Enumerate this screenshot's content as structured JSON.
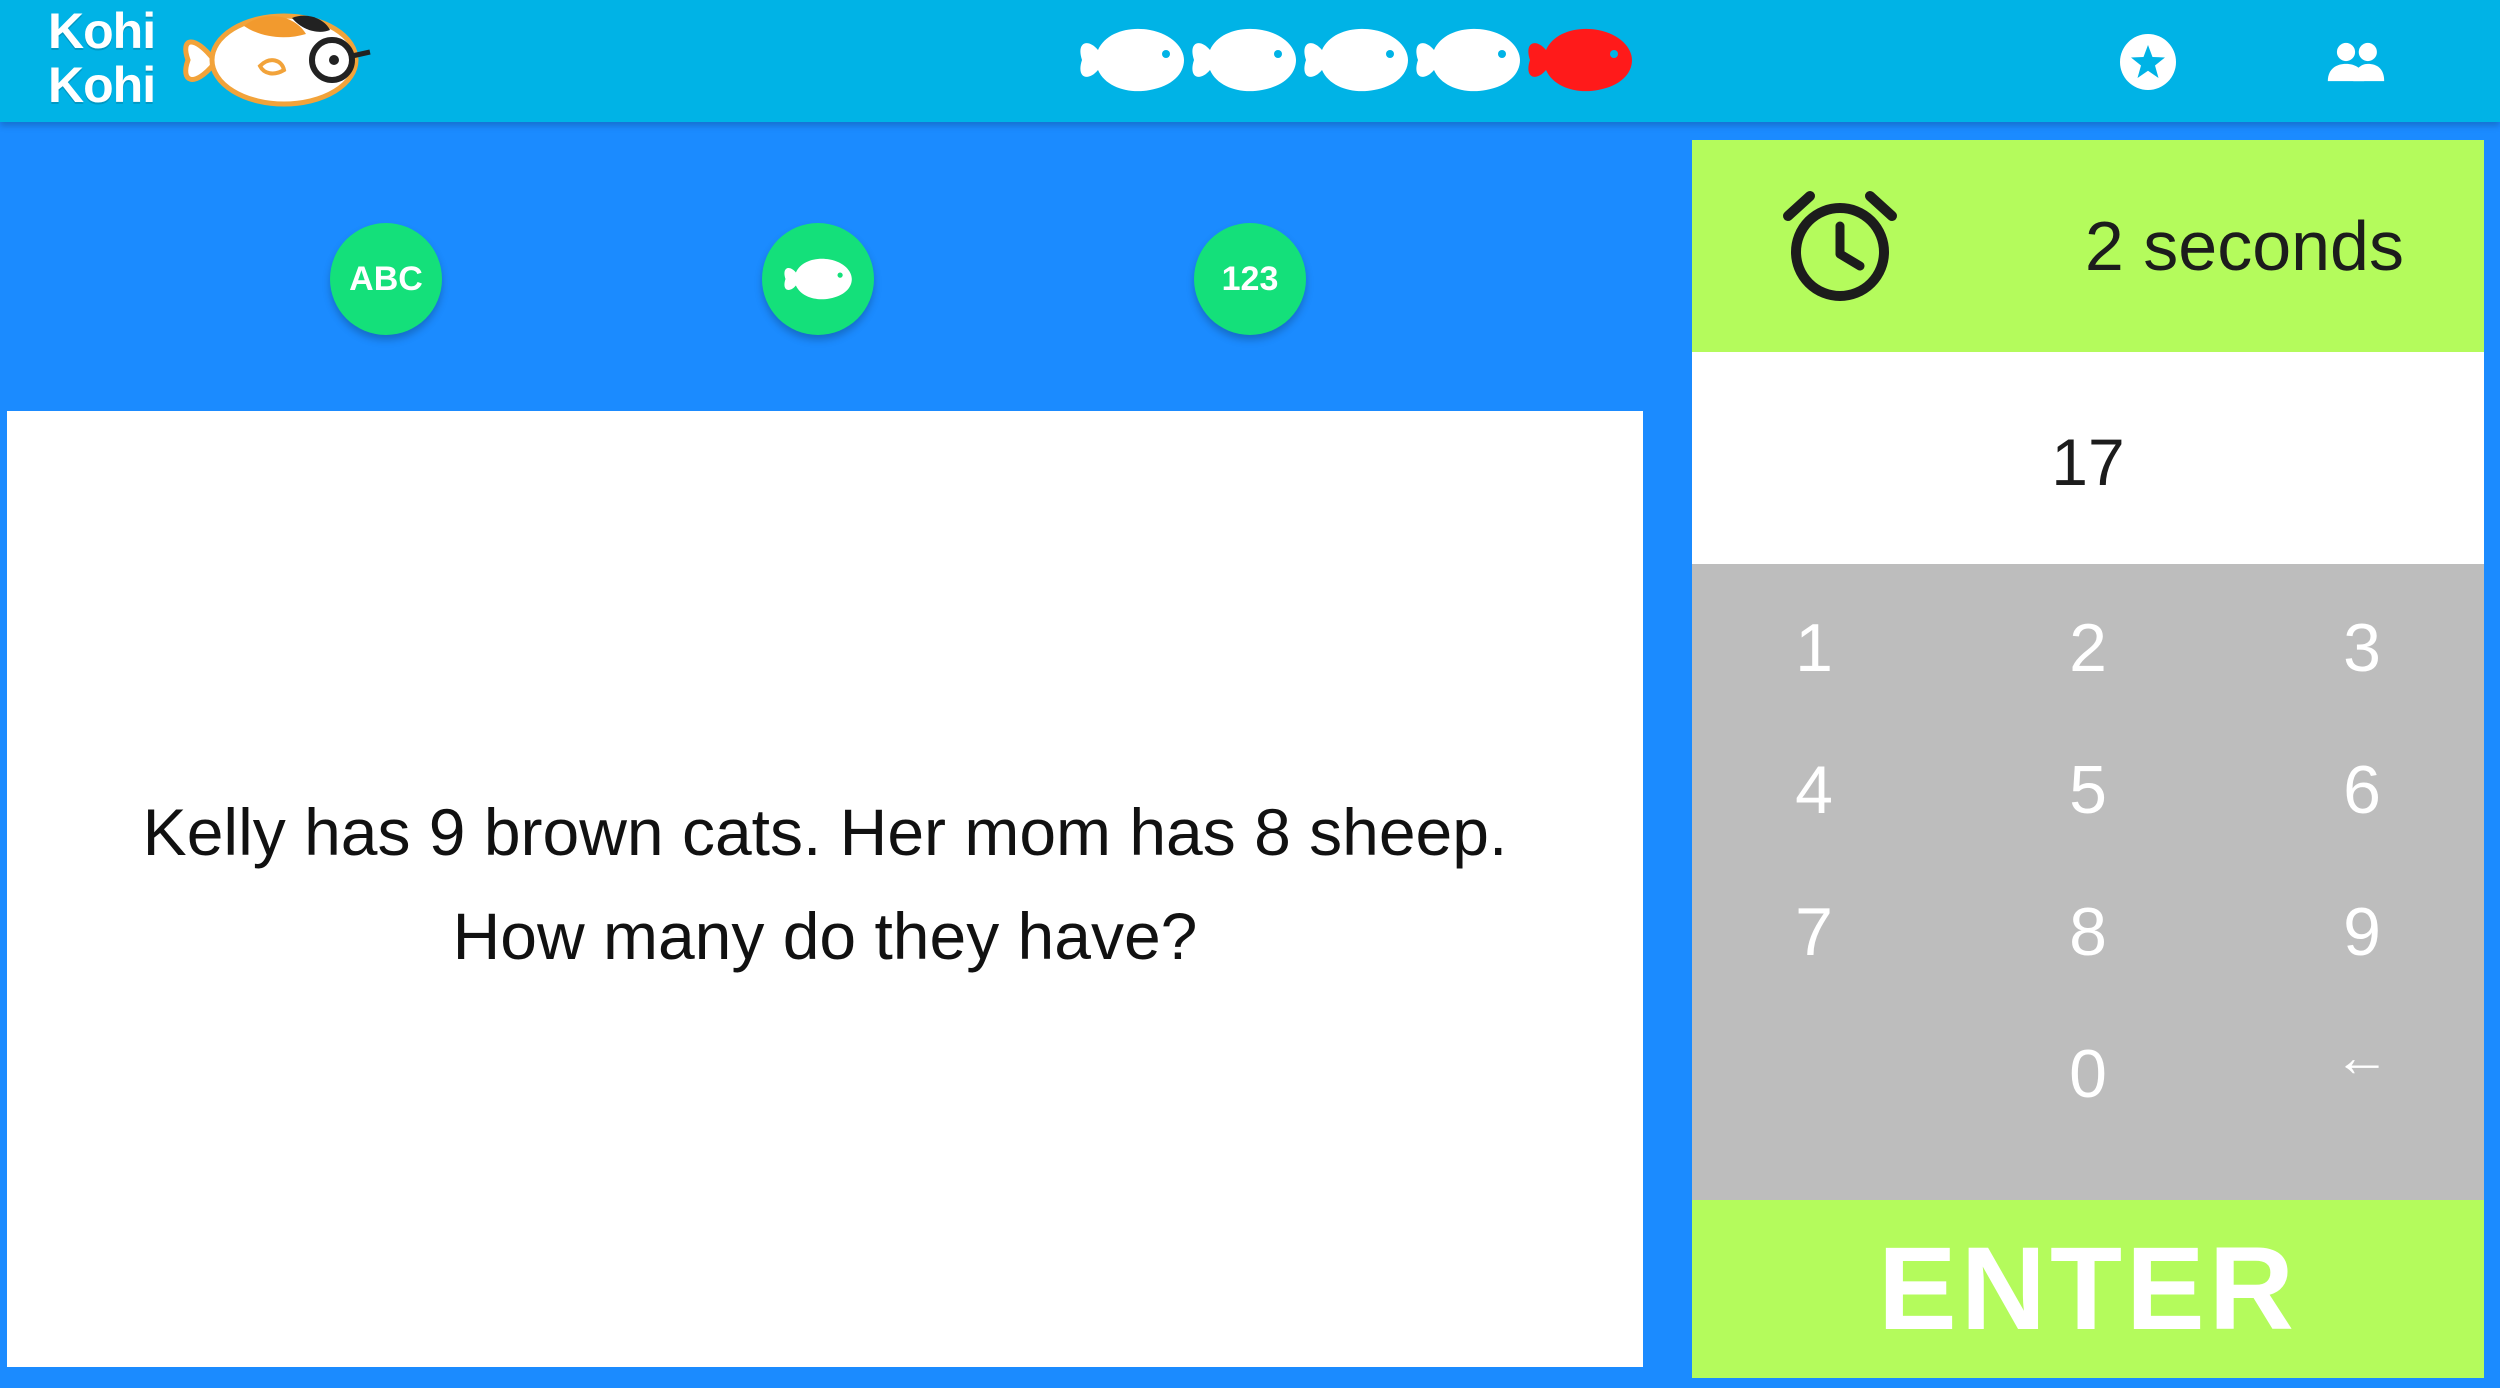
{
  "app": {
    "logo_line1": "Kohi",
    "logo_line2": "Kohi"
  },
  "progress": {
    "total": 5,
    "items": [
      {
        "state": "white"
      },
      {
        "state": "white"
      },
      {
        "state": "white"
      },
      {
        "state": "white"
      },
      {
        "state": "red"
      }
    ]
  },
  "header_icons": [
    {
      "name": "star-icon"
    },
    {
      "name": "friends-icon"
    }
  ],
  "categories": [
    {
      "label": "ABC"
    },
    {
      "label": "",
      "icon": "fish-icon"
    },
    {
      "label": "123"
    }
  ],
  "question": {
    "text": "Kelly has 9 brown cats. Her mom has 8 sheep. How many do they have?"
  },
  "timer": {
    "label": "2 seconds",
    "icon": "alarm-clock-icon"
  },
  "answer": {
    "value": "17"
  },
  "keypad": {
    "keys": [
      "1",
      "2",
      "3",
      "4",
      "5",
      "6",
      "7",
      "8",
      "9",
      "0",
      "←"
    ]
  },
  "enter": {
    "label": "ENTER"
  },
  "colors": {
    "topbar": "#00b3e6",
    "background": "#1b8bff",
    "accent_green": "#14e07a",
    "lime": "#b4fb5c",
    "keypad_gray": "#bdbdbd",
    "fish_active": "#ff1a1a"
  }
}
